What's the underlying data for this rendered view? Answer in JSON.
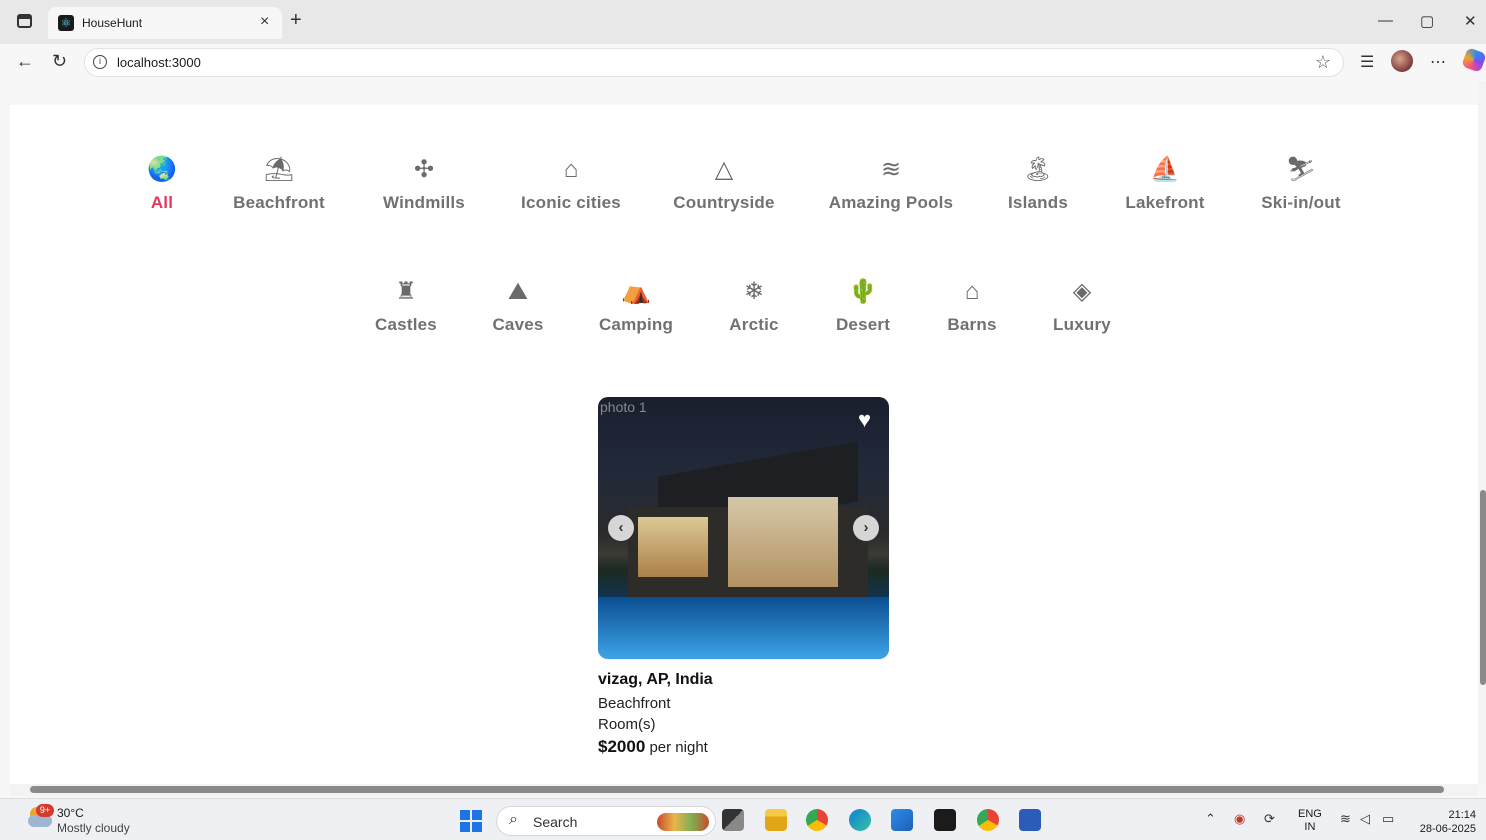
{
  "browser": {
    "tab_title": "HouseHunt",
    "tab_close": "×",
    "new_tab": "+",
    "url": "localhost:3000",
    "window_minimize": "—",
    "window_maximize": "▢",
    "window_close": "✕"
  },
  "categories": {
    "row1": [
      {
        "label": "All",
        "icon": "globe-icon",
        "glyph": "🌏",
        "active": true
      },
      {
        "label": "Beachfront",
        "icon": "umbrella-icon",
        "glyph": "⛱"
      },
      {
        "label": "Windmills",
        "icon": "windmill-icon",
        "glyph": "✣"
      },
      {
        "label": "Iconic cities",
        "icon": "city-icon",
        "glyph": "⌂"
      },
      {
        "label": "Countryside",
        "icon": "mountain-icon",
        "glyph": "△"
      },
      {
        "label": "Amazing Pools",
        "icon": "pool-icon",
        "glyph": "≋"
      },
      {
        "label": "Islands",
        "icon": "island-icon",
        "glyph": "🏝"
      },
      {
        "label": "Lakefront",
        "icon": "lake-icon",
        "glyph": "⛵"
      },
      {
        "label": "Ski-in/out",
        "icon": "skiing-icon",
        "glyph": "⛷"
      }
    ],
    "row2": [
      {
        "label": "Castles",
        "icon": "castle-icon",
        "glyph": "♜"
      },
      {
        "label": "Caves",
        "icon": "cave-icon",
        "glyph": "⛰"
      },
      {
        "label": "Camping",
        "icon": "camping-icon",
        "glyph": "⛺"
      },
      {
        "label": "Arctic",
        "icon": "snowflake-icon",
        "glyph": "❄"
      },
      {
        "label": "Desert",
        "icon": "cactus-icon",
        "glyph": "🌵"
      },
      {
        "label": "Barns",
        "icon": "barn-icon",
        "glyph": "⌂"
      },
      {
        "label": "Luxury",
        "icon": "diamond-icon",
        "glyph": "◈"
      }
    ]
  },
  "listing": {
    "image_alt": "photo 1",
    "location": "vizag, AP, India",
    "category": "Beachfront",
    "type": "Room(s)",
    "price": "$2000",
    "price_suffix": "per night"
  },
  "taskbar": {
    "weather_badge": "9+",
    "temperature": "30°C",
    "weather": "Mostly cloudy",
    "search_label": "Search",
    "language": "ENG",
    "region": "IN",
    "time": "21:14",
    "date": "28-06-2025"
  }
}
